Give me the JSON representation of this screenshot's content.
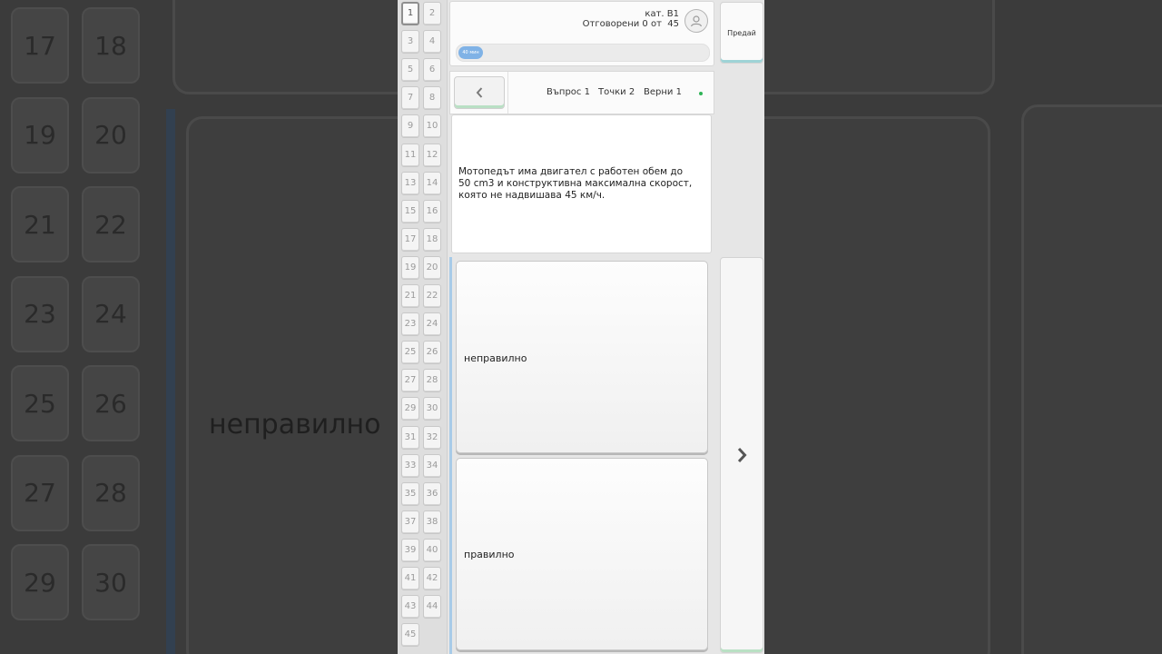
{
  "background": {
    "tiles": [
      "17",
      "18",
      "19",
      "20",
      "21",
      "22",
      "23",
      "24",
      "25",
      "26",
      "27",
      "28",
      "29",
      "30"
    ],
    "answer_text": "неправилно"
  },
  "question_nav": {
    "numbers": [
      "1",
      "2",
      "3",
      "4",
      "5",
      "6",
      "7",
      "8",
      "9",
      "10",
      "11",
      "12",
      "13",
      "14",
      "15",
      "16",
      "17",
      "18",
      "19",
      "20",
      "21",
      "22",
      "23",
      "24",
      "25",
      "26",
      "27",
      "28",
      "29",
      "30",
      "31",
      "32",
      "33",
      "34",
      "35",
      "36",
      "37",
      "38",
      "39",
      "40",
      "41",
      "42",
      "43",
      "44",
      "45"
    ],
    "active": "1"
  },
  "header": {
    "category": "кат. B1",
    "answered_label": "Отговорени 0 от",
    "answered_total": "45",
    "timer_label": "40 мин",
    "timer_progress": 0.1
  },
  "submit": {
    "label": "Предай"
  },
  "navbar": {
    "question": "Въпрос 1",
    "points": "Точки 2",
    "correct": "Верни 1"
  },
  "question": {
    "text": "Мотопедът има двигател с работен обем до 50 cm3 и конструктивна максимална скорост, която не надвишава 45 км/ч."
  },
  "answers": [
    "неправилно",
    "правилно"
  ],
  "colors": {
    "accent_blue": "#7fb2e6",
    "accent_green": "#2fb457"
  },
  "icons": {
    "back": "chevron-left-icon",
    "next": "chevron-right-icon",
    "user": "user-icon"
  }
}
